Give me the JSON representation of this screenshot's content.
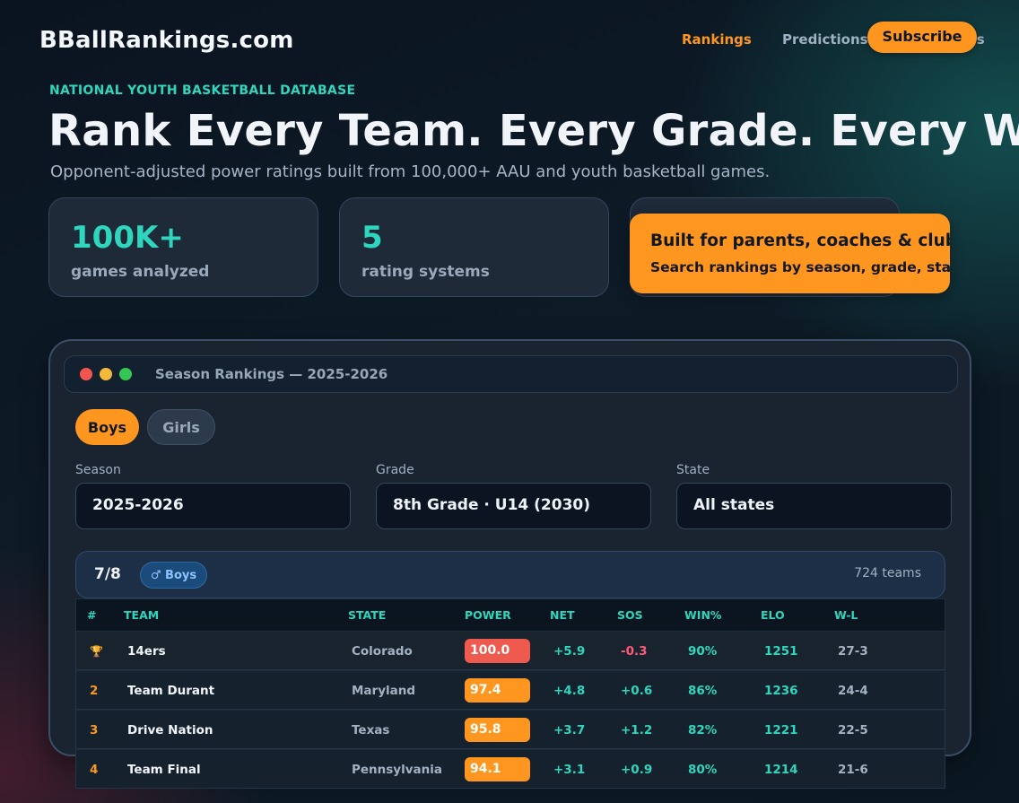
{
  "header": {
    "logo": "BBallRankings.com",
    "nav": [
      {
        "label": "Rankings",
        "active": true
      },
      {
        "label": "Predictions",
        "active": false
      },
      {
        "label": "gs",
        "active": false
      }
    ],
    "subscribe_label": "Subscribe"
  },
  "hero": {
    "eyebrow": "NATIONAL YOUTH BASKETBALL DATABASE",
    "headline": "Rank Every Team. Every Grade. Every We",
    "subhead": "Opponent-adjusted power ratings built from 100,000+ AAU and youth basketball games."
  },
  "stats": [
    {
      "value": "100K+",
      "label": "games analyzed"
    },
    {
      "value": "5",
      "label": "rating systems"
    }
  ],
  "callout": {
    "title": "Built for parents, coaches & clubs",
    "text": "Search rankings by season, grade, state and"
  },
  "app": {
    "window_title": "Season Rankings — 2025-2026",
    "gender_tabs": [
      {
        "label": "Boys",
        "active": true
      },
      {
        "label": "Girls",
        "active": false
      }
    ],
    "filters": [
      {
        "label": "Season",
        "value": "2025-2026"
      },
      {
        "label": "Grade",
        "value": "8th Grade · U14 (2030)"
      },
      {
        "label": "State",
        "value": "All states"
      }
    ],
    "group": {
      "grade_short": "7/8",
      "gender_badge": "♂ Boys",
      "team_count": "724 teams"
    },
    "table": {
      "columns": [
        "#",
        "TEAM",
        "STATE",
        "POWER",
        "NET",
        "SOS",
        "WIN%",
        "ELO",
        "W-L"
      ],
      "rows": [
        {
          "rank": "🏆",
          "team": "14ers",
          "state": "Colorado",
          "power": "100.0",
          "power_color": "#ef5a4f",
          "net": "+5.9",
          "sos": "-0.3",
          "sos_negative": true,
          "win": "90%",
          "elo": "1251",
          "wl": "27-3"
        },
        {
          "rank": "2",
          "team": "Team Durant",
          "state": "Maryland",
          "power": "97.4",
          "power_color": "#ff9620",
          "net": "+4.8",
          "sos": "+0.6",
          "sos_negative": false,
          "win": "86%",
          "elo": "1236",
          "wl": "24-4"
        },
        {
          "rank": "3",
          "team": "Drive Nation",
          "state": "Texas",
          "power": "95.8",
          "power_color": "#ff9620",
          "net": "+3.7",
          "sos": "+1.2",
          "sos_negative": false,
          "win": "82%",
          "elo": "1221",
          "wl": "22-5"
        },
        {
          "rank": "4",
          "team": "Team Final",
          "state": "Pennsylvania",
          "power": "94.1",
          "power_color": "#ff9620",
          "net": "+3.1",
          "sos": "+0.9",
          "sos_negative": false,
          "win": "80%",
          "elo": "1214",
          "wl": "21-6"
        }
      ]
    }
  },
  "colors": {
    "accent": "#ff9620",
    "teal": "#2fd6bd",
    "negative": "#ff5a7a",
    "background": "#0d1b27"
  }
}
